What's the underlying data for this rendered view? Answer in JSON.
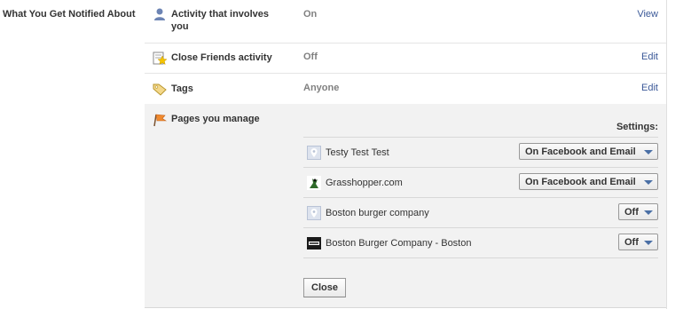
{
  "section": {
    "title": "What You Get Notified About"
  },
  "rows": [
    {
      "icon": "person-icon",
      "label": "Activity that involves you",
      "value": "On",
      "action": "View"
    },
    {
      "icon": "star-icon",
      "label": "Close Friends activity",
      "value": "Off",
      "action": "Edit"
    },
    {
      "icon": "tag-icon",
      "label": "Tags",
      "value": "Anyone",
      "action": "Edit"
    }
  ],
  "pages": {
    "label": "Pages you manage",
    "icon": "flag-icon",
    "settings_header": "Settings:",
    "items": [
      {
        "name": "Testy Test Test",
        "icon": "map-pin-icon",
        "setting": "On Facebook and Email"
      },
      {
        "name": "Grasshopper.com",
        "icon": "grasshopper-logo-icon",
        "setting": "On Facebook and Email"
      },
      {
        "name": "Boston burger company",
        "icon": "map-pin-icon",
        "setting": "Off"
      },
      {
        "name": "Boston Burger Company - Boston",
        "icon": "restaurant-logo-icon",
        "setting": "Off"
      }
    ],
    "close_label": "Close"
  },
  "colors": {
    "link": "#3b5998",
    "muted": "#808080",
    "panel_bg": "#f2f2f2"
  }
}
